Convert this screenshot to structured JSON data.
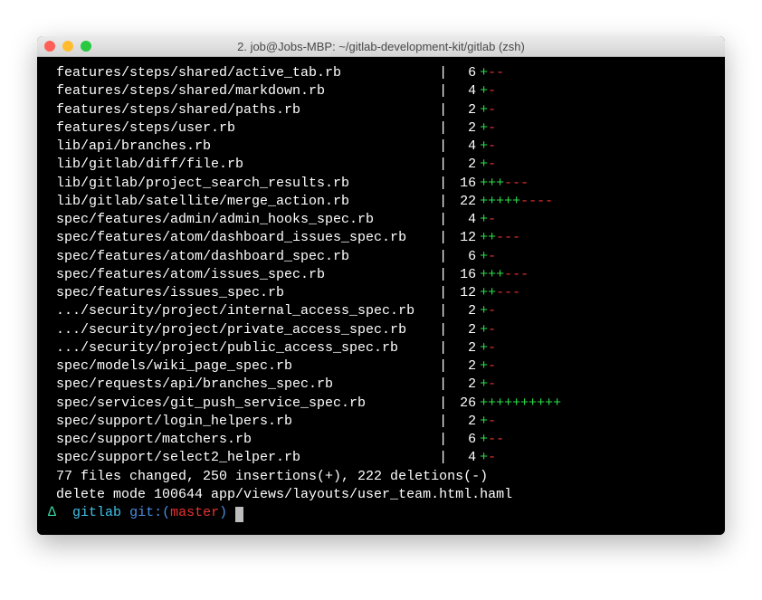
{
  "window": {
    "title": "2. job@Jobs-MBP: ~/gitlab-development-kit/gitlab (zsh)"
  },
  "diff_rows": [
    {
      "path": "features/steps/shared/active_tab.rb",
      "count": 6,
      "plus": "+",
      "minus": "--"
    },
    {
      "path": "features/steps/shared/markdown.rb",
      "count": 4,
      "plus": "+",
      "minus": "-"
    },
    {
      "path": "features/steps/shared/paths.rb",
      "count": 2,
      "plus": "+",
      "minus": "-"
    },
    {
      "path": "features/steps/user.rb",
      "count": 2,
      "plus": "+",
      "minus": "-"
    },
    {
      "path": "lib/api/branches.rb",
      "count": 4,
      "plus": "+",
      "minus": "-"
    },
    {
      "path": "lib/gitlab/diff/file.rb",
      "count": 2,
      "plus": "+",
      "minus": "-"
    },
    {
      "path": "lib/gitlab/project_search_results.rb",
      "count": 16,
      "plus": "+++",
      "minus": "---"
    },
    {
      "path": "lib/gitlab/satellite/merge_action.rb",
      "count": 22,
      "plus": "+++++",
      "minus": "----"
    },
    {
      "path": "spec/features/admin/admin_hooks_spec.rb",
      "count": 4,
      "plus": "+",
      "minus": "-"
    },
    {
      "path": "spec/features/atom/dashboard_issues_spec.rb",
      "count": 12,
      "plus": "++",
      "minus": "---"
    },
    {
      "path": "spec/features/atom/dashboard_spec.rb",
      "count": 6,
      "plus": "+",
      "minus": "-"
    },
    {
      "path": "spec/features/atom/issues_spec.rb",
      "count": 16,
      "plus": "+++",
      "minus": "---"
    },
    {
      "path": "spec/features/issues_spec.rb",
      "count": 12,
      "plus": "++",
      "minus": "---"
    },
    {
      "path": ".../security/project/internal_access_spec.rb",
      "count": 2,
      "plus": "+",
      "minus": "-"
    },
    {
      "path": ".../security/project/private_access_spec.rb",
      "count": 2,
      "plus": "+",
      "minus": "-"
    },
    {
      "path": ".../security/project/public_access_spec.rb",
      "count": 2,
      "plus": "+",
      "minus": "-"
    },
    {
      "path": "spec/models/wiki_page_spec.rb",
      "count": 2,
      "plus": "+",
      "minus": "-"
    },
    {
      "path": "spec/requests/api/branches_spec.rb",
      "count": 2,
      "plus": "+",
      "minus": "-"
    },
    {
      "path": "spec/services/git_push_service_spec.rb",
      "count": 26,
      "plus": "++++++++++",
      "minus": ""
    },
    {
      "path": "spec/support/login_helpers.rb",
      "count": 2,
      "plus": "+",
      "minus": "-"
    },
    {
      "path": "spec/support/matchers.rb",
      "count": 6,
      "plus": "+",
      "minus": "--"
    },
    {
      "path": "spec/support/select2_helper.rb",
      "count": 4,
      "plus": "+",
      "minus": "-"
    }
  ],
  "summary_lines": [
    " 77 files changed, 250 insertions(+), 222 deletions(-)",
    " delete mode 100644 app/views/layouts/user_team.html.haml"
  ],
  "prompt": {
    "symbol": "∆",
    "dir": "gitlab",
    "git_label": "git:",
    "branch": "master"
  }
}
